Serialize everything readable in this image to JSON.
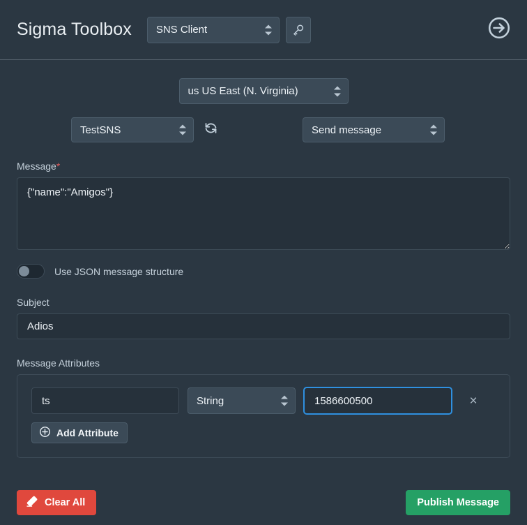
{
  "header": {
    "app_title": "Sigma Toolbox",
    "client_select": {
      "value": "SNS Client",
      "name": "client-select"
    },
    "credentials_button": {
      "icon": "key-icon",
      "label": ""
    },
    "forward_button": {
      "icon": "arrow-right-circle-icon",
      "label": ""
    }
  },
  "toolbar": {
    "region_select": {
      "value": "us US East (N. Virginia)"
    },
    "topic_select": {
      "value": "TestSNS"
    },
    "refresh_button": {
      "icon": "refresh-icon"
    },
    "action_select": {
      "value": "Send message"
    }
  },
  "form": {
    "message": {
      "label": "Message",
      "required_marker": "*",
      "value": "{\"name\":\"Amigos\"}",
      "placeholder": ""
    },
    "json_toggle": {
      "label": "Use JSON message structure",
      "state": "off"
    },
    "subject": {
      "label": "Subject",
      "value": "Adios",
      "placeholder": ""
    },
    "message_attributes": {
      "label": "Message Attributes",
      "add_button": {
        "label": "Add Attribute",
        "icon": "plus-circle-icon"
      },
      "remove_icon": "×",
      "rows": [
        {
          "name": "ts",
          "type": "String",
          "value": "1586600500",
          "name_placeholder": "",
          "value_placeholder": ""
        }
      ]
    }
  },
  "footer": {
    "clear_button": {
      "label": "Clear All",
      "icon": "eraser-icon"
    },
    "publish_button": {
      "label": "Publish Message"
    }
  },
  "colors": {
    "app_background": "#2b3742",
    "panel_input": "#26313b",
    "control_surface": "#3b4a57",
    "border": "#3e4c58",
    "accent_focus": "#2f90e0",
    "danger": "#e0483d",
    "success": "#25a065",
    "required": "#e05c5c",
    "text_primary": "#eef3f7",
    "text_muted": "#c6d2dc"
  }
}
